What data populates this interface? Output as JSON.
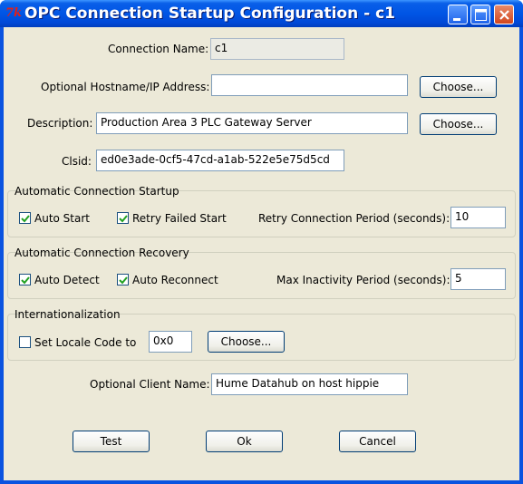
{
  "window": {
    "title": "OPC Connection Startup Configuration - c1",
    "app_icon_glyph": "7k"
  },
  "form": {
    "connection_name_label": "Connection Name:",
    "connection_name_value": "c1",
    "hostname_label": "Optional Hostname/IP Address:",
    "hostname_value": "",
    "hostname_choose": "Choose...",
    "description_label": "Description:",
    "description_value": "Production Area 3 PLC Gateway Server",
    "description_choose": "Choose...",
    "clsid_label": "Clsid:",
    "clsid_value": "ed0e3ade-0cf5-47cd-a1ab-522e5e75d5cd"
  },
  "startup": {
    "title": "Automatic Connection Startup",
    "auto_start_label": "Auto Start",
    "auto_start_checked": true,
    "retry_label": "Retry Failed Start",
    "retry_checked": true,
    "period_label": "Retry Connection Period (seconds):",
    "period_value": "10"
  },
  "recovery": {
    "title": "Automatic Connection Recovery",
    "auto_detect_label": "Auto Detect",
    "auto_detect_checked": true,
    "auto_reconnect_label": "Auto Reconnect",
    "auto_reconnect_checked": true,
    "inactivity_label": "Max Inactivity Period (seconds):",
    "inactivity_value": "5"
  },
  "i18n": {
    "title": "Internationalization",
    "locale_label": "Set Locale Code to",
    "locale_checked": false,
    "locale_value": "0x0",
    "locale_choose": "Choose..."
  },
  "client": {
    "name_label": "Optional Client Name:",
    "name_value": "Hume Datahub on host hippie"
  },
  "buttons": {
    "test": "Test",
    "ok": "Ok",
    "cancel": "Cancel"
  },
  "colors": {
    "titlebar": "#0055e5",
    "client_bg": "#ece9d8",
    "field_border": "#7f9db9",
    "check_mark": "#21a121"
  }
}
